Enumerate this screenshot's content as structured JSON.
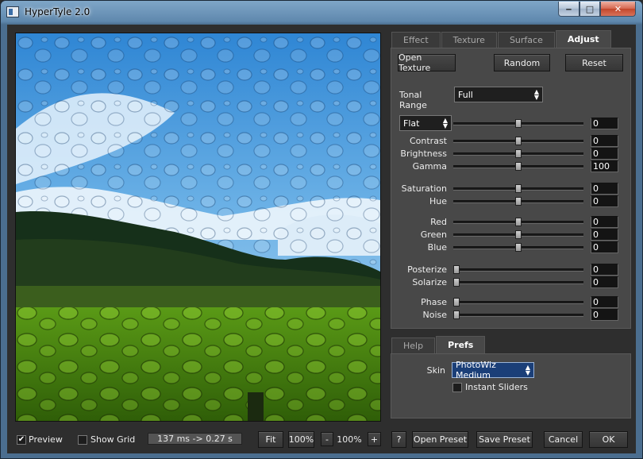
{
  "window": {
    "title": "HyperTyle 2.0",
    "minimize_glyph": "‒",
    "maximize_glyph": "□",
    "close_glyph": "✕"
  },
  "tabs_top": [
    {
      "label": "Effect",
      "active": false
    },
    {
      "label": "Texture",
      "active": false
    },
    {
      "label": "Surface",
      "active": false
    },
    {
      "label": "Adjust",
      "active": true
    }
  ],
  "adjust": {
    "open_texture": "Open Texture",
    "random": "Random",
    "reset": "Reset",
    "tonal_range_label": "Tonal Range",
    "tonal_range_value": "Full",
    "mode_value": "Flat",
    "mode_amount": "0",
    "sliders": [
      {
        "label": "Contrast",
        "value": "0",
        "pos": 0.5
      },
      {
        "label": "Brightness",
        "value": "0",
        "pos": 0.5
      },
      {
        "label": "Gamma",
        "value": "100",
        "pos": 0.5
      },
      {
        "label": "Saturation",
        "value": "0",
        "pos": 0.5
      },
      {
        "label": "Hue",
        "value": "0",
        "pos": 0.5
      },
      {
        "label": "Red",
        "value": "0",
        "pos": 0.5
      },
      {
        "label": "Green",
        "value": "0",
        "pos": 0.5
      },
      {
        "label": "Blue",
        "value": "0",
        "pos": 0.5
      },
      {
        "label": "Posterize",
        "value": "0",
        "pos": 0
      },
      {
        "label": "Solarize",
        "value": "0",
        "pos": 0
      },
      {
        "label": "Phase",
        "value": "0",
        "pos": 0
      },
      {
        "label": "Noise",
        "value": "0",
        "pos": 0
      }
    ]
  },
  "tabs_bottom": [
    {
      "label": "Help",
      "active": false
    },
    {
      "label": "Prefs",
      "active": true
    }
  ],
  "prefs": {
    "skin_label": "Skin",
    "skin_value": "PhotoWiz Medium",
    "instant_sliders_label": "Instant Sliders",
    "instant_sliders_checked": false
  },
  "statusbar": {
    "preview_label": "Preview",
    "preview_checked": true,
    "show_grid_label": "Show Grid",
    "show_grid_checked": false,
    "timing": "137 ms -> 0.27 s",
    "fit": "Fit",
    "zoom_100": "100%",
    "zoom_minus": "-",
    "zoom_level": "100%",
    "zoom_plus": "+",
    "help": "?",
    "open_preset": "Open Preset",
    "save_preset": "Save Preset",
    "cancel": "Cancel",
    "ok": "OK"
  },
  "colors": {
    "background": "#2e2e2e",
    "panel": "#484848",
    "sky": "#4f97d6",
    "grass": "#4f8a12"
  }
}
